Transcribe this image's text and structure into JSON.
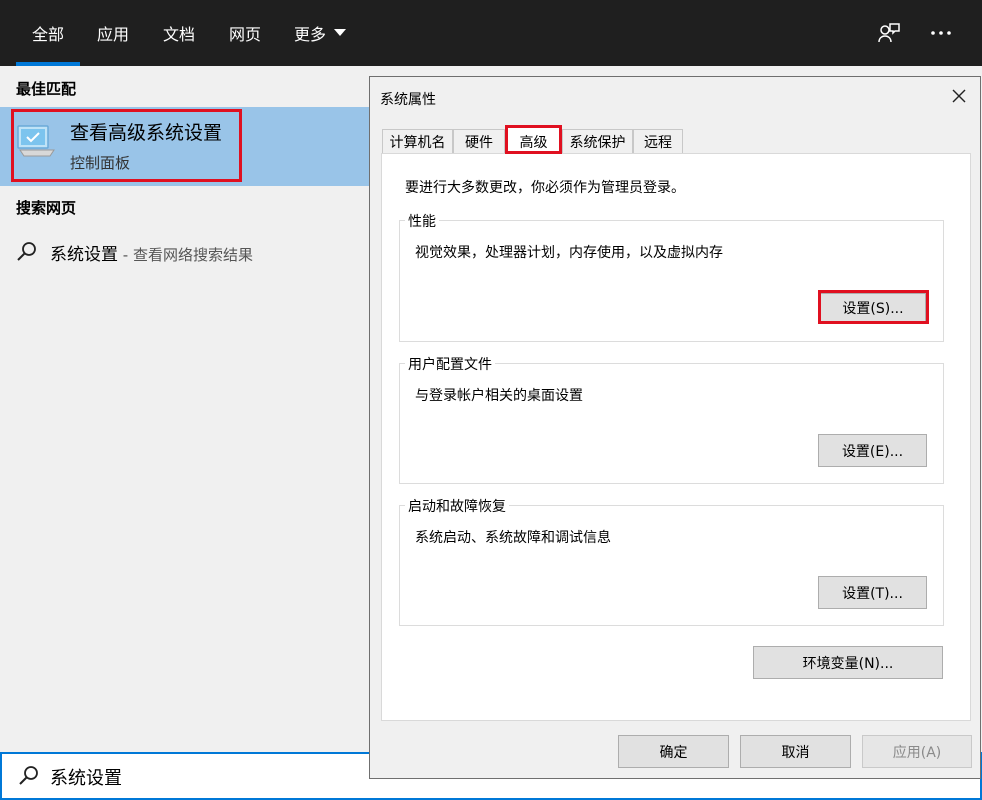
{
  "search_tabs": [
    {
      "label": "全部"
    },
    {
      "label": "应用"
    },
    {
      "label": "文档"
    },
    {
      "label": "网页"
    },
    {
      "label": "更多"
    }
  ],
  "best_match": {
    "section_title": "最佳匹配",
    "title": "查看高级系统设置",
    "subtitle": "控制面板"
  },
  "web_search": {
    "section_title": "搜索网页",
    "query": "系统设置",
    "suffix": " - 查看网络搜索结果"
  },
  "search_input": {
    "value": "系统设置"
  },
  "dialog": {
    "title": "系统属性",
    "tabs": [
      "计算机名",
      "硬件",
      "高级",
      "系统保护",
      "远程"
    ],
    "active_tab": "高级",
    "admin_note": "要进行大多数更改，你必须作为管理员登录。",
    "performance": {
      "label": "性能",
      "desc": "视觉效果，处理器计划，内存使用，以及虚拟内存",
      "button": "设置(S)..."
    },
    "user_profiles": {
      "label": "用户配置文件",
      "desc": "与登录帐户相关的桌面设置",
      "button": "设置(E)..."
    },
    "startup_recovery": {
      "label": "启动和故障恢复",
      "desc": "系统启动、系统故障和调试信息",
      "button": "设置(T)..."
    },
    "env_button": "环境变量(N)...",
    "ok": "确定",
    "cancel": "取消",
    "apply": "应用(A)"
  },
  "colors": {
    "accent": "#0078d7",
    "highlight": "#e01020",
    "selection": "#99c4e8"
  }
}
